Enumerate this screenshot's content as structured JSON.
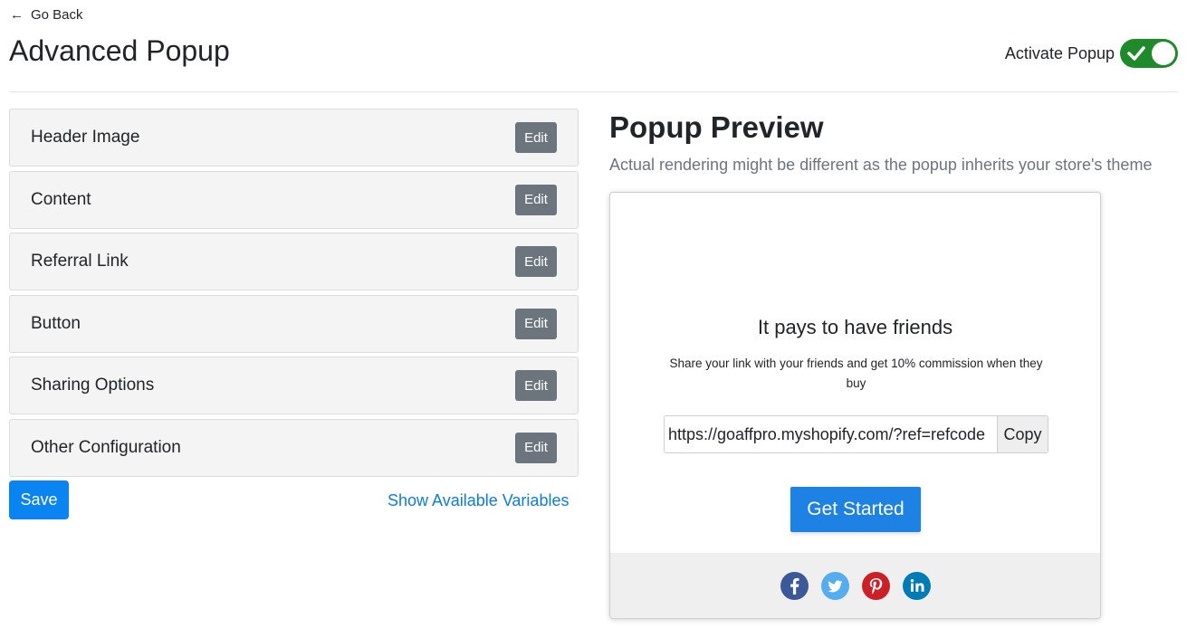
{
  "nav": {
    "back_label": "Go Back",
    "back_icon": "arrow-left-icon"
  },
  "page": {
    "title": "Advanced Popup"
  },
  "activate": {
    "label": "Activate Popup",
    "enabled": true
  },
  "sections": [
    {
      "label": "Header Image",
      "edit_label": "Edit"
    },
    {
      "label": "Content",
      "edit_label": "Edit"
    },
    {
      "label": "Referral Link",
      "edit_label": "Edit"
    },
    {
      "label": "Button",
      "edit_label": "Edit"
    },
    {
      "label": "Sharing Options",
      "edit_label": "Edit"
    },
    {
      "label": "Other Configuration",
      "edit_label": "Edit"
    }
  ],
  "actions": {
    "save_label": "Save",
    "variables_label": "Show Available Variables"
  },
  "preview": {
    "title": "Popup Preview",
    "subtitle": "Actual rendering might be different as the popup inherits your store's theme",
    "heading": "It pays to have friends",
    "text": "Share your link with your friends and get 10% commission when they buy",
    "referral_link": "https://goaffpro.myshopify.com/?ref=refcode",
    "copy_label": "Copy",
    "cta_label": "Get Started",
    "social": [
      {
        "name": "facebook-icon",
        "color": "#3b5998"
      },
      {
        "name": "twitter-icon",
        "color": "#55acee"
      },
      {
        "name": "pinterest-icon",
        "color": "#cb2027"
      },
      {
        "name": "linkedin-icon",
        "color": "#007bb6"
      }
    ]
  },
  "colors": {
    "primary": "#0a84f0",
    "toggle_on": "#1f8a2a",
    "edit_button": "#6c757d",
    "cta": "#1e82e4"
  }
}
